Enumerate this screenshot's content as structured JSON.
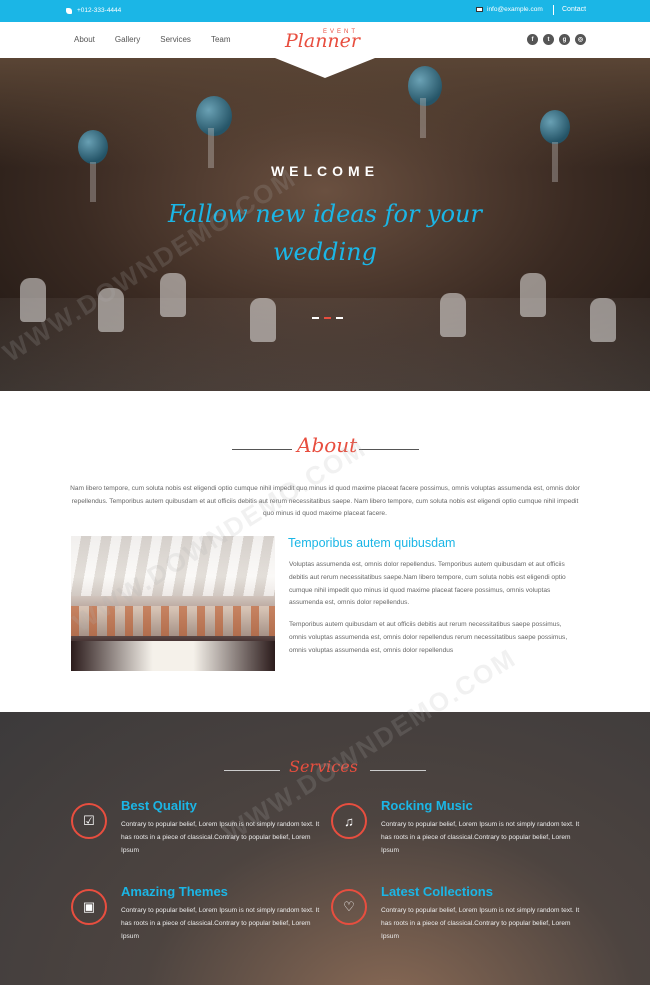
{
  "topbar": {
    "phone": "+012-333-4444",
    "email": "info@example.com",
    "contact_label": "Contact",
    "bg_color": "#1bb6e6"
  },
  "nav": {
    "items": [
      "About",
      "Gallery",
      "Services",
      "Team"
    ],
    "logo_small": "EVENT",
    "logo_main": "Planner",
    "social_icons": [
      "facebook-icon",
      "twitter-icon",
      "google-plus-icon",
      "instagram-icon"
    ]
  },
  "hero": {
    "welcome": "WELCOME",
    "tagline": "Fallow new ideas for your wedding",
    "slide_count": 3,
    "active_slide": 2
  },
  "about": {
    "title": "About",
    "intro": "Nam libero tempore, cum soluta nobis est eligendi optio cumque nihil impedit quo minus id quod maxime placeat facere possimus, omnis voluptas assumenda est, omnis dolor repellendus. Temporibus autem quibusdam et aut officiis debitis aut rerum necessitatibus saepe. Nam libero tempore, cum soluta nobis est eligendi optio cumque nihil impedit quo minus id quod maxime placeat facere.",
    "subtitle": "Temporibus autem quibusdam",
    "para1": "Voluptas assumenda est, omnis dolor repellendus. Temporibus autem quibusdam et aut officiis debitis aut rerum necessitatibus saepe.Nam libero tempore, cum soluta nobis est eligendi optio cumque nihil impedit quo minus id quod maxime placeat facere possimus, omnis voluptas assumenda est, omnis dolor repellendus.",
    "para2": "Temporibus autem quibusdam et aut officiis debitis aut rerum necessitatibus saepe possimus, omnis voluptas assumenda est, omnis dolor repellendus rerum necessitatibus saepe possimus, omnis voluptas assumenda est, omnis dolor repellendus"
  },
  "services": {
    "title": "Services",
    "items": [
      {
        "title": "Best Quality",
        "icon": "check-icon",
        "text": "Contrary to popular belief, Lorem Ipsum is not simply random text. It has roots in a piece of classical.Contrary to popular belief, Lorem Ipsum"
      },
      {
        "title": "Rocking Music",
        "icon": "music-note-icon",
        "text": "Contrary to popular belief, Lorem Ipsum is not simply random text. It has roots in a piece of classical.Contrary to popular belief, Lorem Ipsum"
      },
      {
        "title": "Amazing Themes",
        "icon": "image-icon",
        "text": "Contrary to popular belief, Lorem Ipsum is not simply random text. It has roots in a piece of classical.Contrary to popular belief, Lorem Ipsum"
      },
      {
        "title": "Latest Collections",
        "icon": "heart-icon",
        "text": "Contrary to popular belief, Lorem Ipsum is not simply random text. It has roots in a piece of classical.Contrary to popular belief, Lorem Ipsum"
      }
    ]
  },
  "watermark": "WWW.DOWNDEMO.COM",
  "colors": {
    "accent": "#e84e3f",
    "primary": "#1bb6e6"
  }
}
